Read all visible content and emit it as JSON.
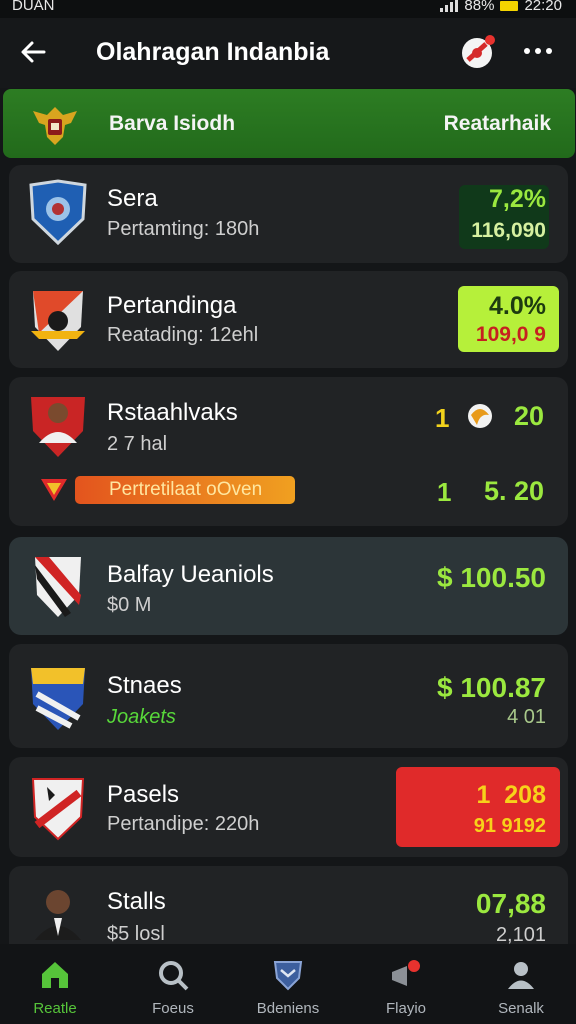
{
  "status_bar": {
    "left_text": "DUAN",
    "battery": "88%",
    "time": "22:20"
  },
  "app_bar": {
    "title": "Olahragan  Indanbia"
  },
  "banner": {
    "left_label": "Barva Isiodh",
    "right_label": "Reatarhaik"
  },
  "cards": [
    {
      "name": "Sera",
      "sub": "Pertamting: 180h",
      "value": "7,2%",
      "value2": "116,090"
    },
    {
      "name": "Pertandinga",
      "sub": "Reatading: 12ehl",
      "value": "4.0%",
      "value2": "109,0 9"
    },
    {
      "name": "Rstaahlvaks",
      "sub": "2 7 hal",
      "score_a": "1",
      "score_b": "20",
      "tag": "Pertretilaat oOven",
      "score_c": "1",
      "score_d": "5. 20"
    },
    {
      "name": "Balfay Ueaniols",
      "sub": "$0 M",
      "value": "$ 100.50"
    },
    {
      "name": "Stnaes",
      "sub": "Joakets",
      "value": "$ 100.87",
      "value2": "4 01"
    },
    {
      "name": "Pasels",
      "sub": "Pertandipe: 220h",
      "value": "1  208",
      "value2": "91 9192"
    },
    {
      "name": "Stalls",
      "sub": "$5 losl",
      "value": "07,88",
      "value2": "2,101"
    }
  ],
  "nav": [
    {
      "label": "Reatle",
      "icon": "home-icon"
    },
    {
      "label": "Foeus",
      "icon": "search-icon"
    },
    {
      "label": "Bdeniens",
      "icon": "shield-icon"
    },
    {
      "label": "Flayio",
      "icon": "megaphone-icon"
    },
    {
      "label": "Senalk",
      "icon": "profile-icon"
    }
  ],
  "colors": {
    "accent_green": "#56c43a",
    "value_green": "#9be83f",
    "alert_red": "#e02a2a",
    "lime": "#b6f03a"
  }
}
